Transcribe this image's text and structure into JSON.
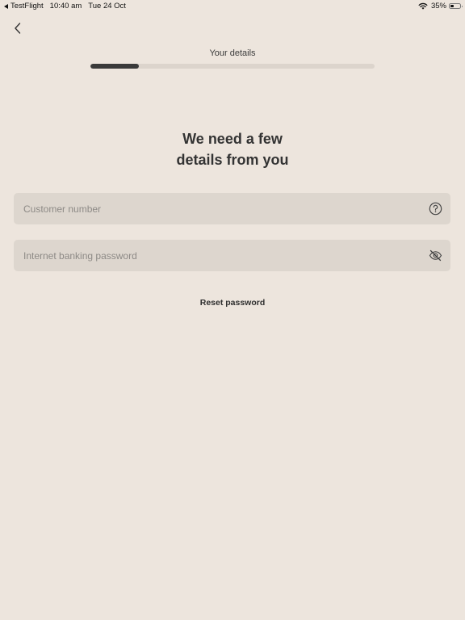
{
  "status_bar": {
    "back_app": "TestFlight",
    "time": "10:40 am",
    "date": "Tue 24 Oct",
    "battery_percent": "35%",
    "battery_level": 0.35
  },
  "header": {
    "back_icon": "chevron-left-icon",
    "step_label": "Your details",
    "progress": 0.17
  },
  "main": {
    "title_line1": "We need a few",
    "title_line2": "details from you",
    "customer_number": {
      "placeholder": "Customer number",
      "value": "",
      "icon": "help-circle-icon"
    },
    "password": {
      "placeholder": "Internet banking password",
      "value": "",
      "icon": "eye-off-icon"
    },
    "reset_link": "Reset password"
  },
  "colors": {
    "background": "#EDE5DD",
    "field_background": "#DDD6CE",
    "progress_track": "#DCD4CC",
    "progress_fill": "#3A3A3A",
    "text": "#2F2F2F"
  }
}
